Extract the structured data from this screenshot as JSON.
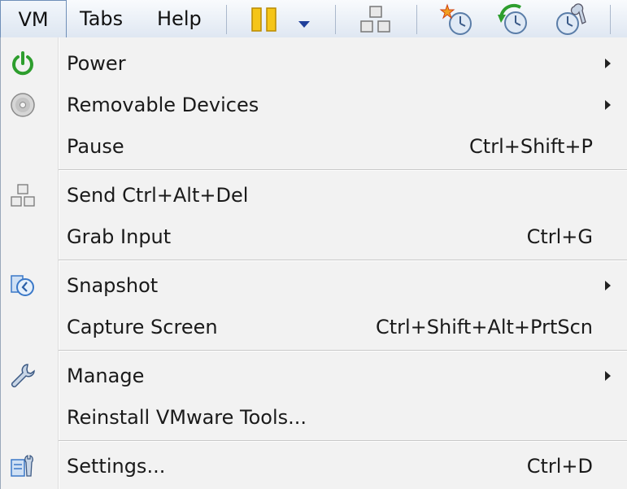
{
  "menubar": {
    "vm_label": "VM",
    "tabs_label": "Tabs",
    "help_label": "Help"
  },
  "toolbar": {
    "icons": [
      "pause-icon",
      "dropdown-arrow-icon",
      "send-ctrl-alt-del-icon",
      "take-snapshot-icon",
      "revert-snapshot-icon",
      "snapshot-manager-icon"
    ]
  },
  "menu": {
    "power": {
      "label": "Power",
      "icon": "power-icon",
      "submenu": true
    },
    "removable_devices": {
      "label": "Removable Devices",
      "icon": "disc-icon",
      "submenu": true
    },
    "pause": {
      "label": "Pause",
      "shortcut": "Ctrl+Shift+P"
    },
    "send_cad": {
      "label": "Send Ctrl+Alt+Del",
      "icon": "send-ctrl-alt-del-icon"
    },
    "grab_input": {
      "label": "Grab Input",
      "shortcut": "Ctrl+G"
    },
    "snapshot": {
      "label": "Snapshot",
      "icon": "snapshot-icon",
      "submenu": true
    },
    "capture_screen": {
      "label": "Capture Screen",
      "shortcut": "Ctrl+Shift+Alt+PrtScn"
    },
    "manage": {
      "label": "Manage",
      "icon": "wrench-icon",
      "submenu": true
    },
    "reinstall_tools": {
      "label": "Reinstall VMware Tools..."
    },
    "settings": {
      "label": "Settings...",
      "icon": "settings-icon",
      "shortcut": "Ctrl+D"
    }
  },
  "colors": {
    "menu_bg": "#f2f2f2",
    "menubar_bg": "#dfe7f2",
    "power_green": "#2e9e2e",
    "icon_blue": "#3a78c8",
    "pause_yellow": "#f2c21a"
  }
}
